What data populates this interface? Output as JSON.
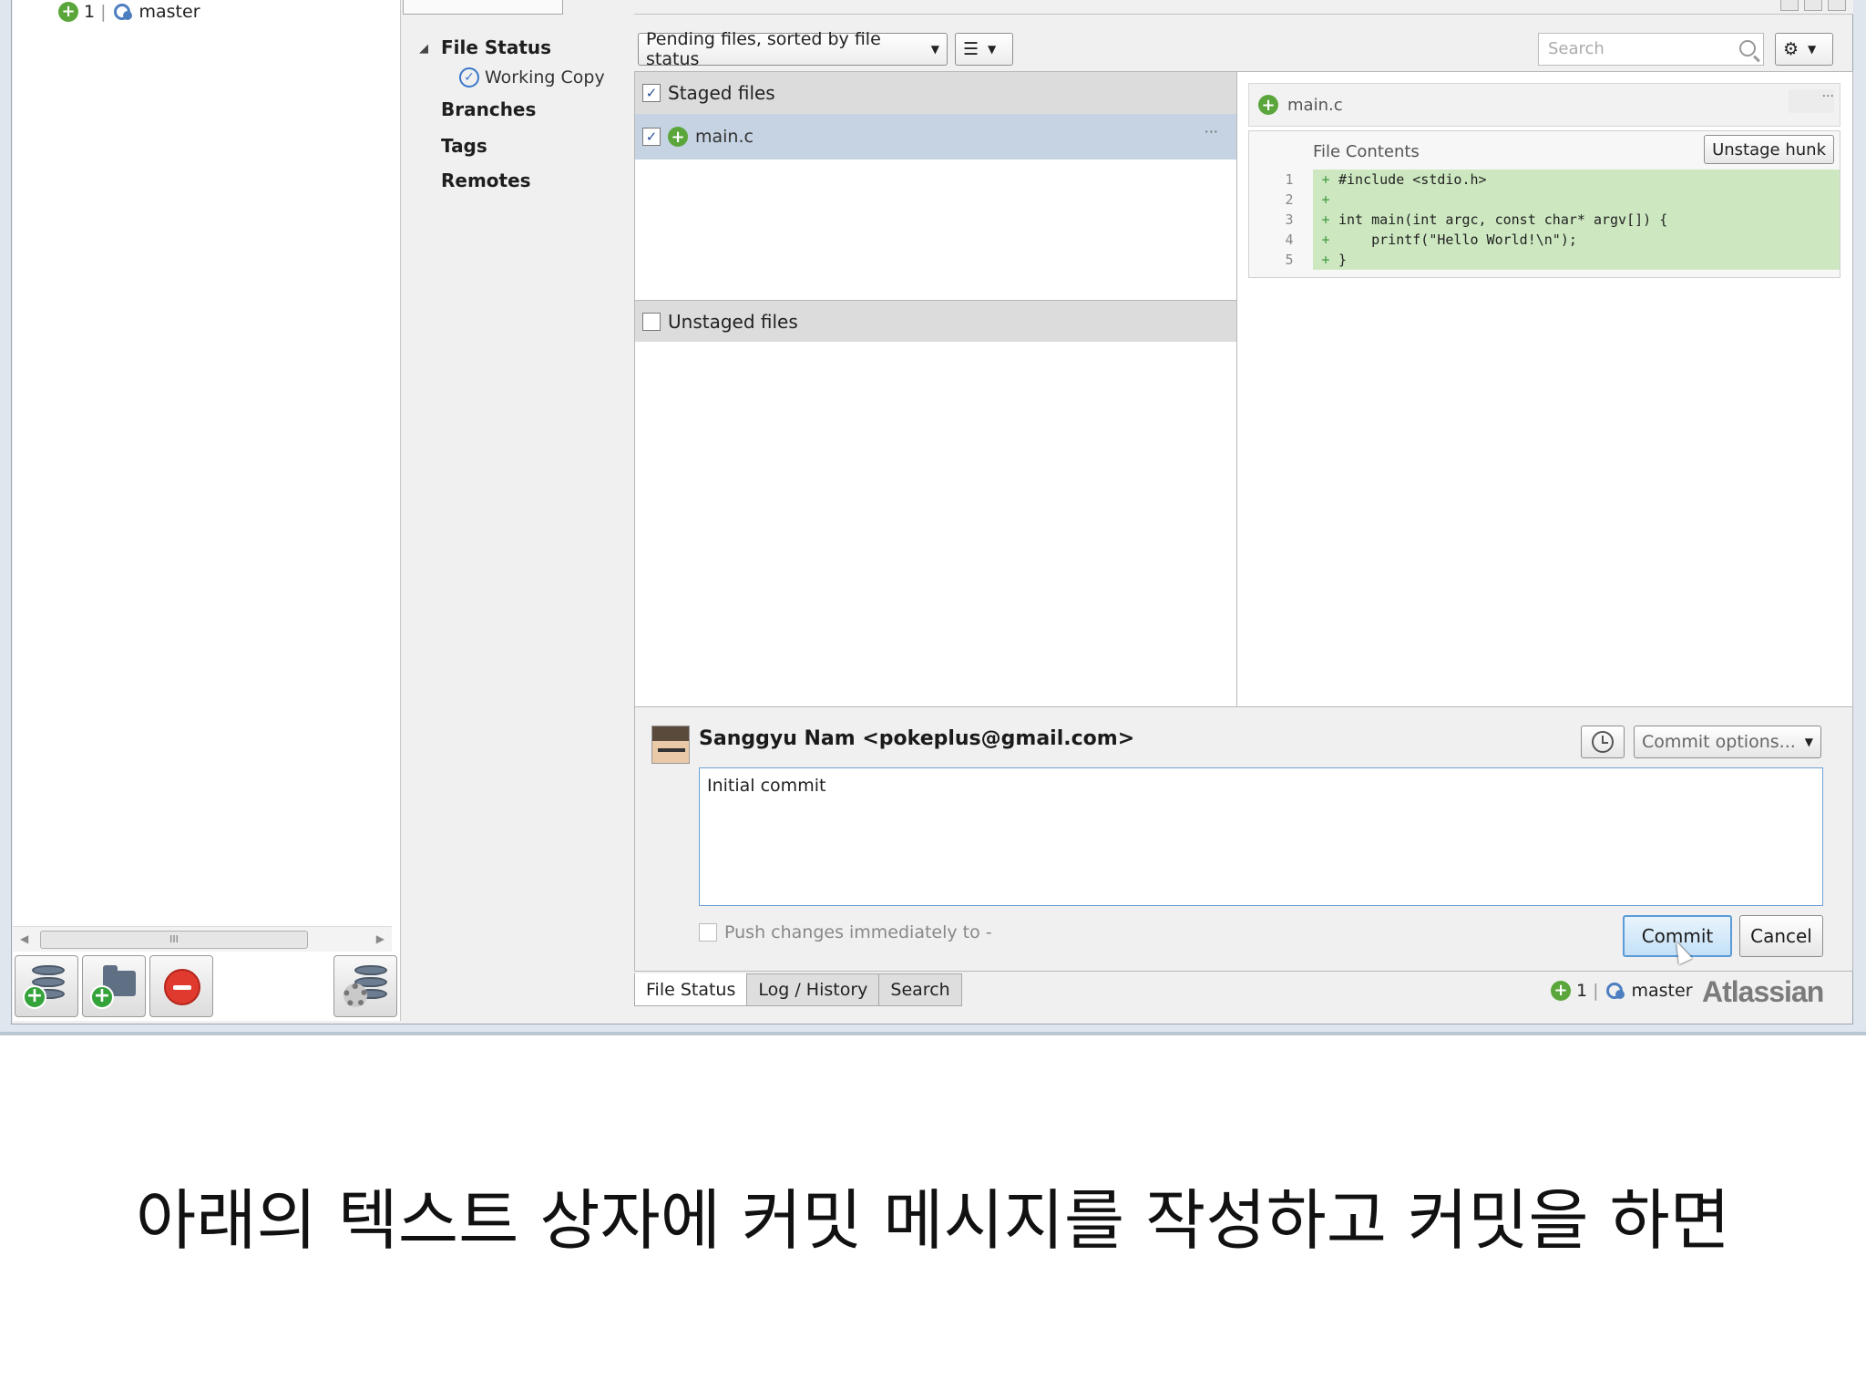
{
  "repo_status": {
    "count": "1",
    "separator": "|",
    "branch": "master"
  },
  "sidebar": {
    "file_status": "File Status",
    "working_copy": "Working Copy",
    "branches": "Branches",
    "tags": "Tags",
    "remotes": "Remotes"
  },
  "toolbar": {
    "view_combo": "Pending files, sorted by file status",
    "search_placeholder": "Search"
  },
  "staged": {
    "header": "Staged files",
    "files": [
      "main.c"
    ],
    "more": "···"
  },
  "unstaged": {
    "header": "Unstaged files"
  },
  "diff": {
    "filename": "main.c",
    "more": "···",
    "hunk_title": "File Contents",
    "unstage_hunk": "Unstage hunk",
    "lines": [
      {
        "n": "1",
        "sign": "+",
        "code": "#include <stdio.h>"
      },
      {
        "n": "2",
        "sign": "+",
        "code": ""
      },
      {
        "n": "3",
        "sign": "+",
        "code": "int main(int argc, const char* argv[]) {"
      },
      {
        "n": "4",
        "sign": "+",
        "code": "    printf(\"Hello World!\\n\");"
      },
      {
        "n": "5",
        "sign": "+",
        "code": "}"
      }
    ]
  },
  "commit": {
    "author": "Sanggyu Nam <pokeplus@gmail.com>",
    "options_label": "Commit options...",
    "message": "Initial commit",
    "push_label": "Push changes immediately to -",
    "commit_label": "Commit",
    "cancel_label": "Cancel"
  },
  "tabs": [
    "File Status",
    "Log / History",
    "Search"
  ],
  "footer": {
    "count": "1",
    "separator": "|",
    "branch": "master",
    "brand": "Atlassian"
  },
  "hscroll_thumb": "III",
  "caption": "아래의 텍스트 상자에 커밋 메시지를 작성하고 커밋을 하면",
  "colors": {
    "accent": "#5a9bd8",
    "added_bg": "#cde8c0",
    "plus_green": "#5aa63b"
  }
}
